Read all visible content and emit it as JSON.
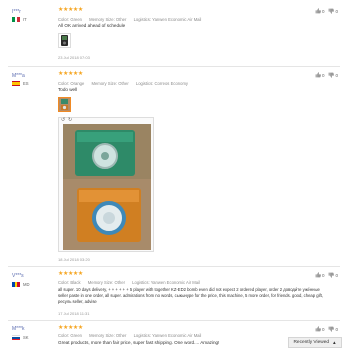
{
  "reviews": [
    {
      "user": "I***r",
      "country": "IT",
      "flag_colors": [
        "#009246",
        "#ffffff",
        "#ce2b37"
      ],
      "stars": "★★★★★",
      "color": "Color: Green",
      "memory": "Memory Size: Other",
      "logistics": "Logistics: Yanwen Economic Air Mail",
      "text": "All OK arrived ahead of schedule",
      "date": "23 Jul 2018 07:03",
      "helpful_yes": "0",
      "helpful_no": "0"
    },
    {
      "user": "M***a",
      "country": "ES",
      "flag_colors": [
        "#c60b1e",
        "#ffc400",
        "#c60b1e"
      ],
      "stars": "★★★★★",
      "color": "Color: Orange",
      "memory": "Memory Size: Other",
      "logistics": "Logistics: Correos Economy",
      "text": "Todo well",
      "date": "18 Jul 2018 03:20",
      "helpful_yes": "0",
      "helpful_no": "0"
    },
    {
      "user": "V***s",
      "country": "MD",
      "flag_colors": [
        "#0046ae",
        "#ffd200",
        "#cc092f"
      ],
      "stars": "★★★★★",
      "color": "Color: Black",
      "memory": "Memory Size: Other",
      "logistics": "Logistics: Yanwen Economic Air Mail",
      "text": "all super. 10 days delivery, + + + + + + 5 player with together KZ-ED2 bomb even did not expect 2 ordered player, order 2 доводи́те уже́нные seller paste in one order, all super. admirations from no words, сыкынуре for the price, this machine, 5 more order, for friends. good, cheap gift, ресуль seller, advise",
      "date": "17 Jul 2018 11:31",
      "helpful_yes": "0",
      "helpful_no": "0"
    },
    {
      "user": "M***k",
      "country": "SK",
      "flag_colors": [
        "#ffffff",
        "#0b4ea2",
        "#ee1c25"
      ],
      "stars": "★★★★★",
      "color": "Color: Green",
      "memory": "Memory Size: Other",
      "logistics": "Logistics: Yanwen Economic Air Mail",
      "text": "Great products, more than fair price, super fast shipping. One word.... Amazing!",
      "helpful_yes": "0",
      "helpful_no": "0"
    }
  ],
  "recently_viewed": "Recently Viewed"
}
